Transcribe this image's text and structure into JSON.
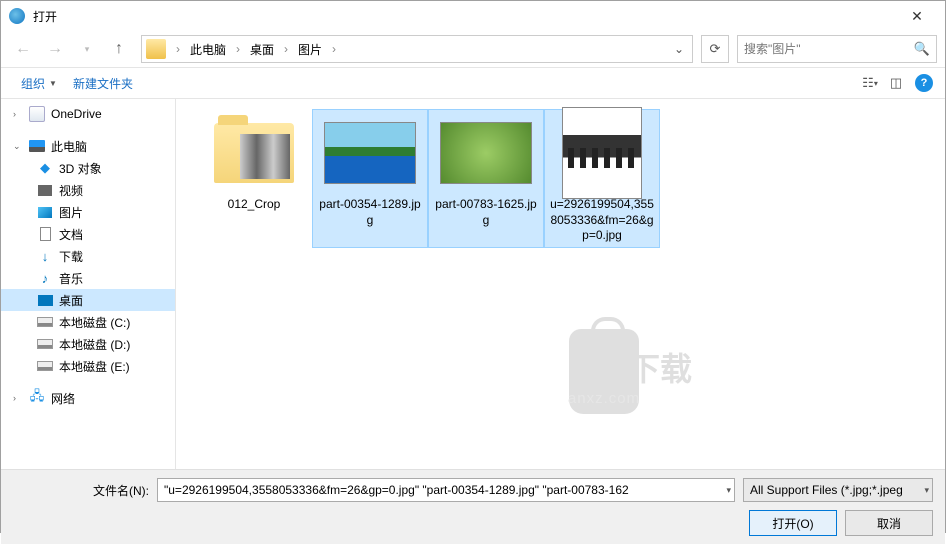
{
  "title": "打开",
  "breadcrumb": {
    "sep": "›",
    "items": [
      "此电脑",
      "桌面",
      "图片"
    ]
  },
  "search": {
    "placeholder": "搜索\"图片\""
  },
  "toolbar": {
    "organize": "组织",
    "newfolder": "新建文件夹"
  },
  "sidebar": {
    "onedrive": "OneDrive",
    "thispc": "此电脑",
    "objects3d": "3D 对象",
    "videos": "视频",
    "pictures": "图片",
    "documents": "文档",
    "downloads": "下载",
    "music": "音乐",
    "desktop": "桌面",
    "driveC": "本地磁盘 (C:)",
    "driveD": "本地磁盘 (D:)",
    "driveE": "本地磁盘 (E:)",
    "network": "网络"
  },
  "files": [
    {
      "name": "012_Crop",
      "type": "folder",
      "selected": false
    },
    {
      "name": "part-00354-1289.jpg",
      "type": "image",
      "selected": true,
      "thumb": "thumb1"
    },
    {
      "name": "part-00783-1625.jpg",
      "type": "image",
      "selected": true,
      "thumb": "thumb2"
    },
    {
      "name": "u=2926199504,3558053336&fm=26&gp=0.jpg",
      "type": "image",
      "selected": true,
      "thumb": "thumb3"
    }
  ],
  "footer": {
    "filename_label": "文件名(N):",
    "filename_value": "\"u=2926199504,3558053336&fm=26&gp=0.jpg\" \"part-00354-1289.jpg\" \"part-00783-162",
    "filetype": "All Support Files (*.jpg;*.jpeg",
    "open": "打开(O)",
    "cancel": "取消"
  },
  "watermark": {
    "t1": "安下载",
    "t2": "anxz.com"
  }
}
